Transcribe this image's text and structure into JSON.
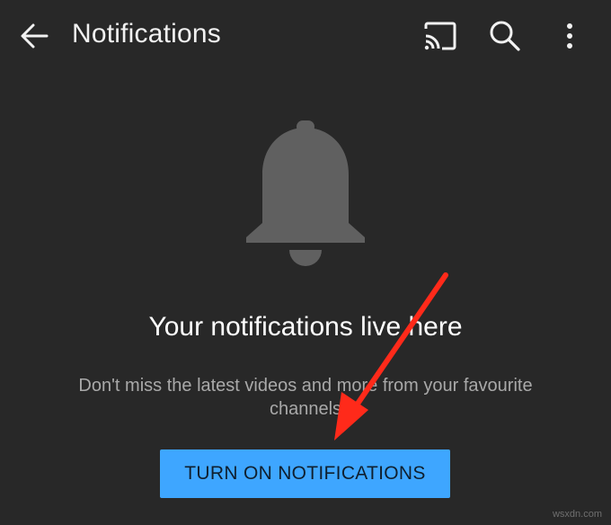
{
  "header": {
    "title": "Notifications",
    "icons": [
      "back-arrow-icon",
      "cast-icon",
      "search-icon",
      "more-vertical-icon"
    ]
  },
  "empty_state": {
    "icon": "bell-icon",
    "headline": "Your notifications live here",
    "description": "Don't miss the latest videos and more from your favourite channels",
    "button_label": "TURN ON NOTIFICATIONS"
  },
  "annotation": {
    "icon": "red-arrow-annotation"
  },
  "watermark": "wsxdn.com",
  "colors": {
    "background": "#282828",
    "button": "#3ea6ff",
    "bell": "#606060",
    "annotation": "#ff2a1a"
  }
}
